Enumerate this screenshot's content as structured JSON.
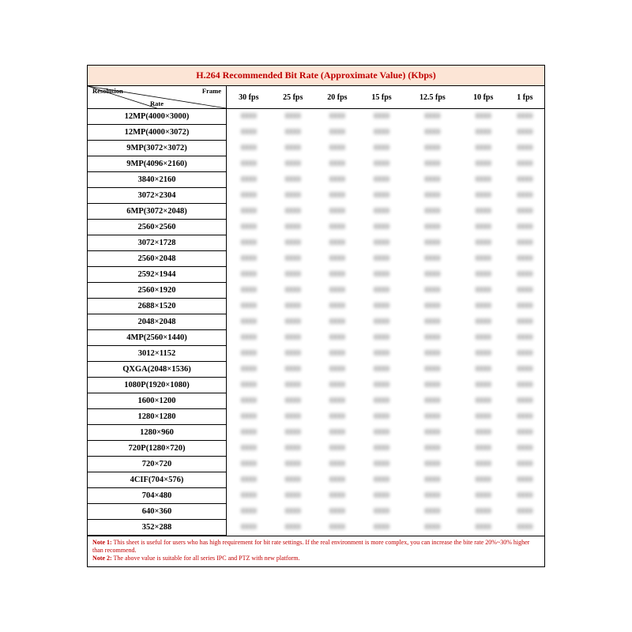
{
  "title": "H.264 Recommended Bit Rate (Approximate Value) (Kbps)",
  "corner": {
    "resolution": "Resolution",
    "frame": "Frame",
    "rate": "Rate"
  },
  "columns": [
    "30 fps",
    "25 fps",
    "20 fps",
    "15 fps",
    "12.5 fps",
    "10 fps",
    "1 fps"
  ],
  "rows": [
    {
      "label": "12MP(4000×3000)",
      "values": [
        "",
        "",
        "",
        "",
        "",
        "",
        ""
      ]
    },
    {
      "label": "12MP(4000×3072)",
      "values": [
        "",
        "",
        "",
        "",
        "",
        "",
        ""
      ]
    },
    {
      "label": "9MP(3072×3072)",
      "values": [
        "",
        "",
        "",
        "",
        "",
        "",
        ""
      ]
    },
    {
      "label": "9MP(4096×2160)",
      "values": [
        "",
        "",
        "",
        "",
        "",
        "",
        ""
      ]
    },
    {
      "label": "3840×2160",
      "values": [
        "",
        "",
        "",
        "",
        "",
        "",
        ""
      ]
    },
    {
      "label": "3072×2304",
      "values": [
        "",
        "",
        "",
        "",
        "",
        "",
        ""
      ]
    },
    {
      "label": "6MP(3072×2048)",
      "values": [
        "",
        "",
        "",
        "",
        "",
        "",
        ""
      ]
    },
    {
      "label": "2560×2560",
      "values": [
        "",
        "",
        "",
        "",
        "",
        "",
        ""
      ]
    },
    {
      "label": "3072×1728",
      "values": [
        "",
        "",
        "",
        "",
        "",
        "",
        ""
      ]
    },
    {
      "label": "2560×2048",
      "values": [
        "",
        "",
        "",
        "",
        "",
        "",
        ""
      ]
    },
    {
      "label": "2592×1944",
      "values": [
        "",
        "",
        "",
        "",
        "",
        "",
        ""
      ]
    },
    {
      "label": "2560×1920",
      "values": [
        "",
        "",
        "",
        "",
        "",
        "",
        ""
      ]
    },
    {
      "label": "2688×1520",
      "values": [
        "",
        "",
        "",
        "",
        "",
        "",
        ""
      ]
    },
    {
      "label": "2048×2048",
      "values": [
        "",
        "",
        "",
        "",
        "",
        "",
        ""
      ]
    },
    {
      "label": "4MP(2560×1440)",
      "values": [
        "",
        "",
        "",
        "",
        "",
        "",
        ""
      ]
    },
    {
      "label": "3012×1152",
      "values": [
        "",
        "",
        "",
        "",
        "",
        "",
        ""
      ]
    },
    {
      "label": "QXGA(2048×1536)",
      "values": [
        "",
        "",
        "",
        "",
        "",
        "",
        ""
      ]
    },
    {
      "label": "1080P(1920×1080)",
      "values": [
        "",
        "",
        "",
        "",
        "",
        "",
        ""
      ]
    },
    {
      "label": "1600×1200",
      "values": [
        "",
        "",
        "",
        "",
        "",
        "",
        ""
      ]
    },
    {
      "label": "1280×1280",
      "values": [
        "",
        "",
        "",
        "",
        "",
        "",
        ""
      ]
    },
    {
      "label": "1280×960",
      "values": [
        "",
        "",
        "",
        "",
        "",
        "",
        ""
      ]
    },
    {
      "label": "720P(1280×720)",
      "values": [
        "",
        "",
        "",
        "",
        "",
        "",
        ""
      ]
    },
    {
      "label": "720×720",
      "values": [
        "",
        "",
        "",
        "",
        "",
        "",
        ""
      ]
    },
    {
      "label": "4CIF(704×576)",
      "values": [
        "",
        "",
        "",
        "",
        "",
        "",
        ""
      ]
    },
    {
      "label": "704×480",
      "values": [
        "",
        "",
        "",
        "",
        "",
        "",
        ""
      ]
    },
    {
      "label": "640×360",
      "values": [
        "",
        "",
        "",
        "",
        "",
        "",
        ""
      ]
    },
    {
      "label": "352×288",
      "values": [
        "",
        "",
        "",
        "",
        "",
        "",
        ""
      ]
    }
  ],
  "notes": {
    "n1_label": "Note 1:",
    "n1_text": " This sheet is useful for users who has high requirement for bit rate settings. If the real environment is more complex, you can increase the bite rate 20%~30% higher than recommend.",
    "n2_label": "Note 2:",
    "n2_text": " The above    value is suitable for all series IPC and PTZ with new platform."
  }
}
